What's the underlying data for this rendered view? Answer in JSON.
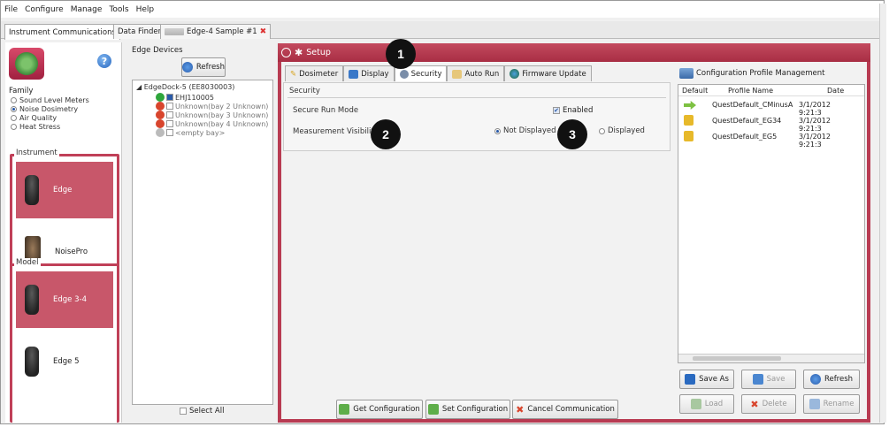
{
  "menu": [
    "File",
    "Configure",
    "Manage",
    "Tools",
    "Help"
  ],
  "tabs": [
    {
      "label": "Instrument Communications"
    },
    {
      "label": "Data Finder"
    },
    {
      "label": "Edge-4 Sample #1"
    }
  ],
  "left": {
    "family_label": "Family",
    "family_options": [
      "Sound Level Meters",
      "Noise Dosimetry",
      "Air Quality",
      "Heat Stress"
    ],
    "family_selected": "Noise Dosimetry",
    "instrument_label": "Instrument",
    "instruments": [
      "Edge",
      "NoisePro"
    ],
    "model_label": "Model",
    "models": [
      "Edge 3-4",
      "Edge 5"
    ]
  },
  "edge": {
    "title": "Edge Devices",
    "refresh": "Refresh",
    "dock": "EdgeDock-5 (EE8030003)",
    "bays": [
      {
        "label": "EHJ110005",
        "status": "ok"
      },
      {
        "label": "Unknown(bay 2 Unknown)",
        "status": "err"
      },
      {
        "label": "Unknown(bay 3 Unknown)",
        "status": "err"
      },
      {
        "label": "Unknown(bay 4 Unknown)",
        "status": "err"
      },
      {
        "label": "<empty bay>",
        "status": "empty"
      }
    ],
    "select_all": "Select All"
  },
  "setup": {
    "title": "Setup",
    "tabs": [
      "Dosimeter",
      "Display",
      "Security",
      "Auto Run",
      "Firmware Update"
    ],
    "active_tab": "Security",
    "section": "Security",
    "secure_run_label": "Secure Run Mode",
    "enabled_label": "Enabled",
    "visibility_label": "Measurement Visibility",
    "not_displayed": "Not Displayed",
    "displayed": "Displayed",
    "buttons": [
      "Get Configuration",
      "Set Configuration",
      "Cancel Communication"
    ]
  },
  "callouts": [
    "1",
    "2",
    "3"
  ],
  "profiles": {
    "title": "Configuration Profile Management",
    "columns": [
      "Default",
      "Profile Name",
      "Date"
    ],
    "rows": [
      {
        "name": "QuestDefault_CMinusA",
        "date": "3/1/2012 9:21:3",
        "icon": "arrow"
      },
      {
        "name": "QuestDefault_EG34",
        "date": "3/1/2012 9:21:3",
        "icon": "lock"
      },
      {
        "name": "QuestDefault_EG5",
        "date": "3/1/2012 9:21:3",
        "icon": "lock"
      }
    ],
    "buttons": [
      "Save As",
      "Save",
      "Refresh",
      "Load",
      "Delete",
      "Rename"
    ]
  }
}
